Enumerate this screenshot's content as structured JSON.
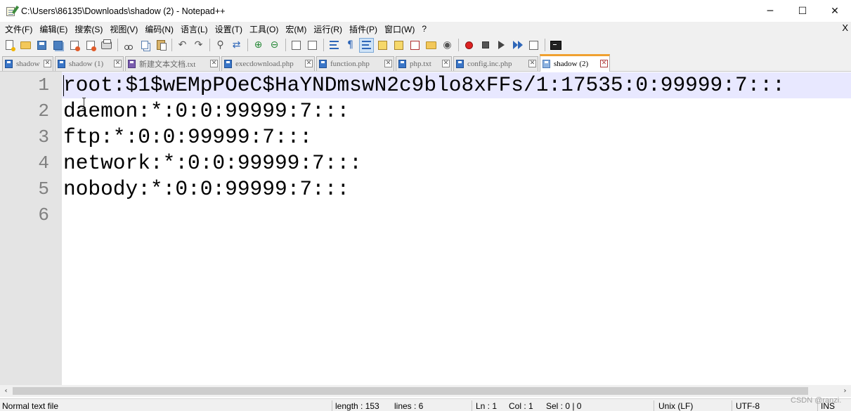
{
  "window": {
    "title": "C:\\Users\\86135\\Downloads\\shadow (2) - Notepad++",
    "controls": {
      "minimize": "─",
      "maximize": "☐",
      "close": "✕"
    }
  },
  "menu": {
    "items": [
      "文件(F)",
      "编辑(E)",
      "搜索(S)",
      "视图(V)",
      "编码(N)",
      "语言(L)",
      "设置(T)",
      "工具(O)",
      "宏(M)",
      "运行(R)",
      "插件(P)",
      "窗口(W)",
      "?"
    ],
    "close": "X"
  },
  "toolbar": {
    "icons": [
      "new-file-icon",
      "open-file-icon",
      "save-icon",
      "save-all-icon",
      "close-icon",
      "close-all-icon",
      "print-icon",
      "cut-icon",
      "copy-icon",
      "paste-icon",
      "undo-icon",
      "redo-icon",
      "find-icon",
      "replace-icon",
      "zoom-in-icon",
      "zoom-out-icon",
      "sync-vertical-icon",
      "sync-horizontal-icon",
      "word-wrap-icon",
      "show-all-chars-icon",
      "indent-guide-icon",
      "user-language-icon",
      "doc-map-icon",
      "function-list-icon",
      "folder-workspace-icon",
      "monitoring-icon",
      "record-macro-icon",
      "stop-record-icon",
      "play-macro-icon",
      "run-macro-multiple-icon",
      "save-macro-icon",
      "console-icon"
    ]
  },
  "tabs": [
    {
      "label": "shadow",
      "icon": "file-saved-icon",
      "active": false
    },
    {
      "label": "shadow (1)",
      "icon": "file-saved-icon",
      "active": false
    },
    {
      "label": "新建文本文档.txt",
      "icon": "file-purple-icon",
      "active": false
    },
    {
      "label": "execdownload.php",
      "icon": "file-saved-icon",
      "active": false
    },
    {
      "label": "function.php",
      "icon": "file-saved-icon",
      "active": false
    },
    {
      "label": "php.txt",
      "icon": "file-saved-icon",
      "active": false
    },
    {
      "label": "config.inc.php",
      "icon": "file-saved-icon",
      "active": false
    },
    {
      "label": "shadow (2)",
      "icon": "file-light-icon",
      "active": true
    }
  ],
  "editor": {
    "lines": [
      {
        "num": "1",
        "text": "root:$1$wEMpPOeC$HaYNDmswN2c9blo8xFFs/1:17535:0:99999:7:::"
      },
      {
        "num": "2",
        "text": "daemon:*:0:0:99999:7:::"
      },
      {
        "num": "3",
        "text": "ftp:*:0:0:99999:7:::"
      },
      {
        "num": "4",
        "text": "network:*:0:0:99999:7:::"
      },
      {
        "num": "5",
        "text": "nobody:*:0:0:99999:7:::"
      },
      {
        "num": "6",
        "text": ""
      }
    ],
    "current_line": 1
  },
  "scrollbar": {
    "left": "‹",
    "right": "›"
  },
  "status": {
    "file_type": "Normal text file",
    "length": "length : 153",
    "lines": "lines : 6",
    "ln": "Ln : 1",
    "col": "Col : 1",
    "sel": "Sel : 0 | 0",
    "eol": "Unix (LF)",
    "encoding": "UTF-8",
    "mode": "INS"
  },
  "watermark": "CSDN @ranzi."
}
